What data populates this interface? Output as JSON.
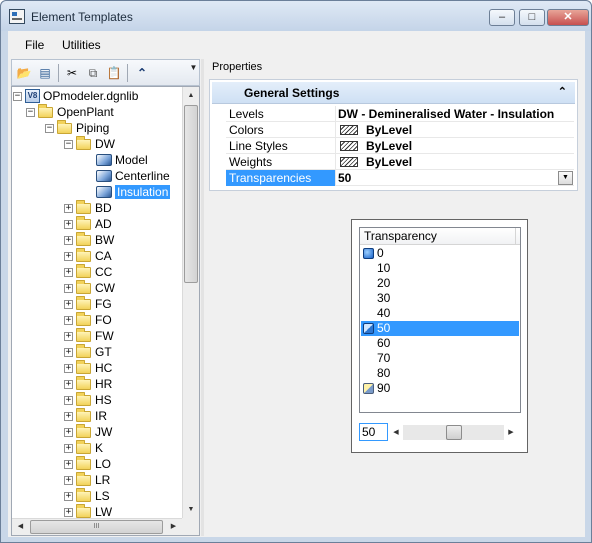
{
  "window": {
    "title": "Element Templates",
    "controls": {
      "minimize": "–",
      "maximize": "□",
      "close": "✕"
    }
  },
  "menu": {
    "file": "File",
    "utilities": "Utilities"
  },
  "toolbar": {
    "icons": [
      "open-folder-icon",
      "library-icon",
      "cut-icon",
      "copy-icon",
      "paste-icon",
      "collapse-icon"
    ],
    "labels": {
      "collapse": "⌃",
      "overflow": "▼"
    }
  },
  "tree": {
    "root": "OPmodeler.dgnlib",
    "openplant": "OpenPlant",
    "piping": "Piping",
    "dw": "DW",
    "templates": [
      "Model",
      "Centerline",
      "Insulation"
    ],
    "selected_template": "Insulation",
    "groups": [
      "BD",
      "AD",
      "BW",
      "CA",
      "CC",
      "CW",
      "FG",
      "FO",
      "FW",
      "GT",
      "HC",
      "HR",
      "HS",
      "IR",
      "JW",
      "K",
      "LO",
      "LR",
      "LS",
      "LW"
    ],
    "hscroll_grip": "III"
  },
  "properties": {
    "section_label": "Properties",
    "category": "General Settings",
    "rows": [
      {
        "name": "Levels",
        "value": "DW - Demineralised Water - Insulation"
      },
      {
        "name": "Colors",
        "value": "ByLevel"
      },
      {
        "name": "Line Styles",
        "value": "ByLevel"
      },
      {
        "name": "Weights",
        "value": "ByLevel"
      },
      {
        "name": "Transparencies",
        "value": "50"
      }
    ]
  },
  "transparency_dropdown": {
    "header": "Transparency",
    "options": [
      "0",
      "10",
      "20",
      "30",
      "40",
      "50",
      "60",
      "70",
      "80",
      "90"
    ],
    "selected": "50",
    "input_value": "50",
    "slider_fraction": 0.5,
    "accent_color": "#3399ff"
  }
}
